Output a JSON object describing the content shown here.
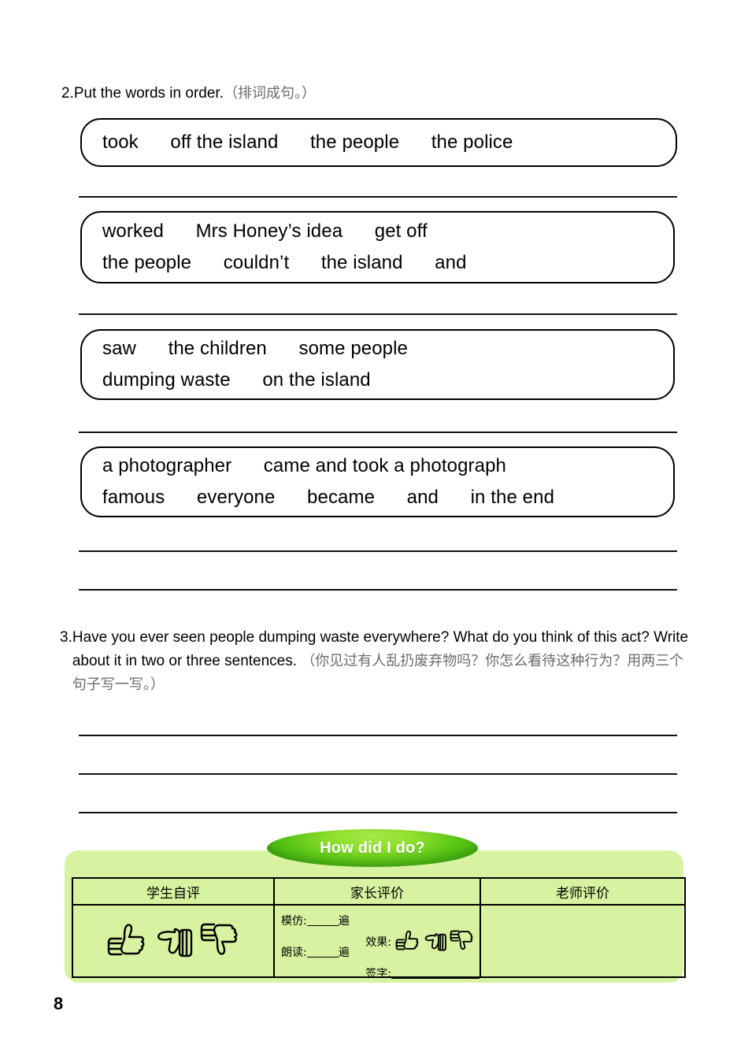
{
  "page": {
    "number": "8"
  },
  "questions": [
    {
      "num": "2.",
      "english": "Put the words in order.",
      "chinese": "（排词成句。）"
    },
    {
      "num": "3.",
      "english": "Have you ever seen people dumping waste everywhere? What do you think of this act? Write about it in two or three sentences.",
      "chinese": "（你见过有人乱扔废弃物吗？你怎么看待这种行为？用两三个句子写一写。）"
    }
  ],
  "word_boxes": [
    {
      "lines": [
        "took      off the island      the people      the police"
      ]
    },
    {
      "lines": [
        "worked      Mrs Honey’s idea      get off",
        "the people      couldn’t      the island      and"
      ]
    },
    {
      "lines": [
        "saw      the children      some people",
        "dumping waste      on the island"
      ]
    },
    {
      "lines": [
        "a photographer      came and took a photograph",
        "famous      everyone      became      and      in the end"
      ]
    }
  ],
  "assessment": {
    "banner_label": "How did I do?",
    "panel_color": "#d7f2a0",
    "banner_color": "#56c316",
    "headers": [
      "学生自评",
      "家长评价",
      "老师评价"
    ],
    "student_cell": {
      "icons": [
        "thumbs-up-icon",
        "thumbs-sideways-icon",
        "thumbs-down-icon"
      ]
    },
    "parent_cell": {
      "imitate_label": "模仿:",
      "imitate_unit": "遍",
      "read_label": "朗读:",
      "read_unit": "遍",
      "effect_label": "效果:",
      "effect_icons": [
        "thumbs-up-icon",
        "thumbs-sideways-icon",
        "thumbs-down-icon"
      ],
      "signature_label": "签字:"
    },
    "teacher_cell": {
      "content": ""
    }
  }
}
